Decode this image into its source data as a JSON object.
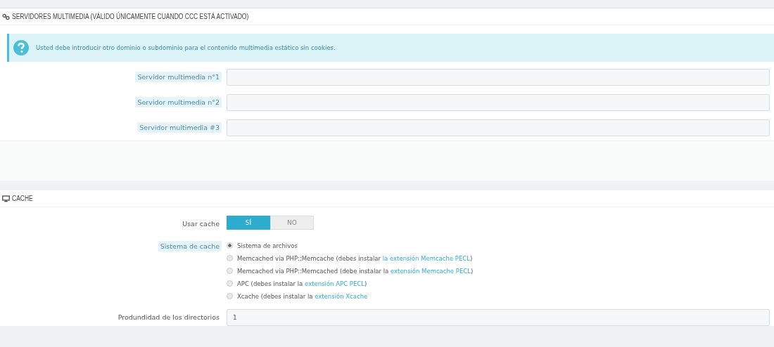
{
  "panels": [
    {
      "title": "SERVIDORES MULTIMEDIA (VÁLIDO ÚNICAMENTE CUANDO CCC ESTÁ ACTIVADO)",
      "alert": "Usted debe introducir otro dominio o subdominio para el contenido multimedia estático sin cookies.",
      "rows": [
        {
          "kind": "text",
          "label": "Servidor multimedia n°1",
          "hint": true
        },
        {
          "kind": "text",
          "label": "Servidor multimedia n°2",
          "hint": true
        },
        {
          "kind": "text",
          "label": "Servidor multimedia #3",
          "hint": true
        }
      ]
    },
    {
      "title": "CACHE",
      "rows": [
        {
          "kind": "switch",
          "label": "Usar cache",
          "hint": false,
          "options": [
            {
              "label": "SÍ",
              "selected": true
            },
            {
              "label": "NO",
              "selected": false
            }
          ]
        },
        {
          "kind": "radio",
          "label": "Sistema de cache",
          "hint": true,
          "options": [
            {
              "text": "Sistema de archivos",
              "selected": true
            },
            {
              "text": "Memcached via PHP::Memcache (debes instalar ",
              "link": "la extensión Memcache PECL",
              "after": ")",
              "selected": false
            },
            {
              "text": "Memcached via PHP::Memcached (debe instalar la ",
              "link": "extensión Memcache PECL",
              "after": ")",
              "selected": false
            },
            {
              "text": "APC (debes instalar la ",
              "link": "extensión APC PECL",
              "after": ")",
              "selected": false
            },
            {
              "text": "Xcache (debes instalar la ",
              "link": "extensión Xcache",
              "selected": false
            }
          ]
        },
        {
          "kind": "text",
          "label": "Produndidad de los directorios",
          "hint": false,
          "value": "1"
        }
      ]
    }
  ]
}
